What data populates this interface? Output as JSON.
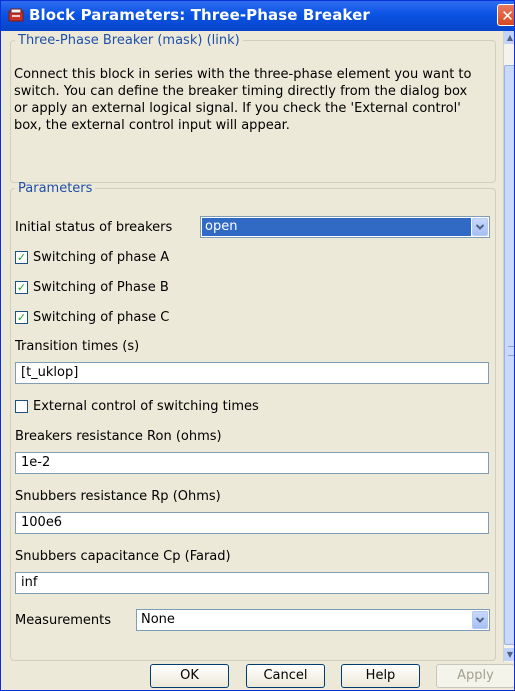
{
  "window": {
    "title": "Block Parameters: Three-Phase Breaker",
    "close_glyph": "✕"
  },
  "mask": {
    "legend": "Three-Phase Breaker (mask) (link)",
    "description": "Connect this block in series with the three-phase element you want to switch. You can define the breaker timing directly from the dialog box or apply an external logical signal. If you check  the 'External control' box, the external control input will appear."
  },
  "parameters": {
    "legend": "Parameters",
    "initial_status": {
      "label": "Initial status of breakers",
      "value": "open"
    },
    "switch_a": {
      "label": "Switching of phase A",
      "checked": true
    },
    "switch_b": {
      "label": "Switching of Phase B",
      "checked": true
    },
    "switch_c": {
      "label": "Switching of phase C",
      "checked": true
    },
    "transition_times": {
      "label": "Transition times (s)",
      "value": "[t_uklop]"
    },
    "external_control": {
      "label": "External control of switching times",
      "checked": false
    },
    "ron": {
      "label": "Breakers resistance Ron (ohms)",
      "value": "1e-2"
    },
    "rp": {
      "label": "Snubbers resistance Rp (Ohms)",
      "value": "100e6"
    },
    "cp": {
      "label": "Snubbers capacitance Cp (Farad)",
      "value": "inf"
    },
    "measurements": {
      "label": "Measurements",
      "value": "None"
    }
  },
  "check_glyph": "✓",
  "buttons": {
    "ok": "OK",
    "cancel": "Cancel",
    "help": "Help",
    "apply": "Apply"
  },
  "colors": {
    "title_bar": "#0a53e3",
    "legend_text": "#1f4fa8",
    "selection": "#316ac5",
    "close_button": "#d84a22"
  }
}
